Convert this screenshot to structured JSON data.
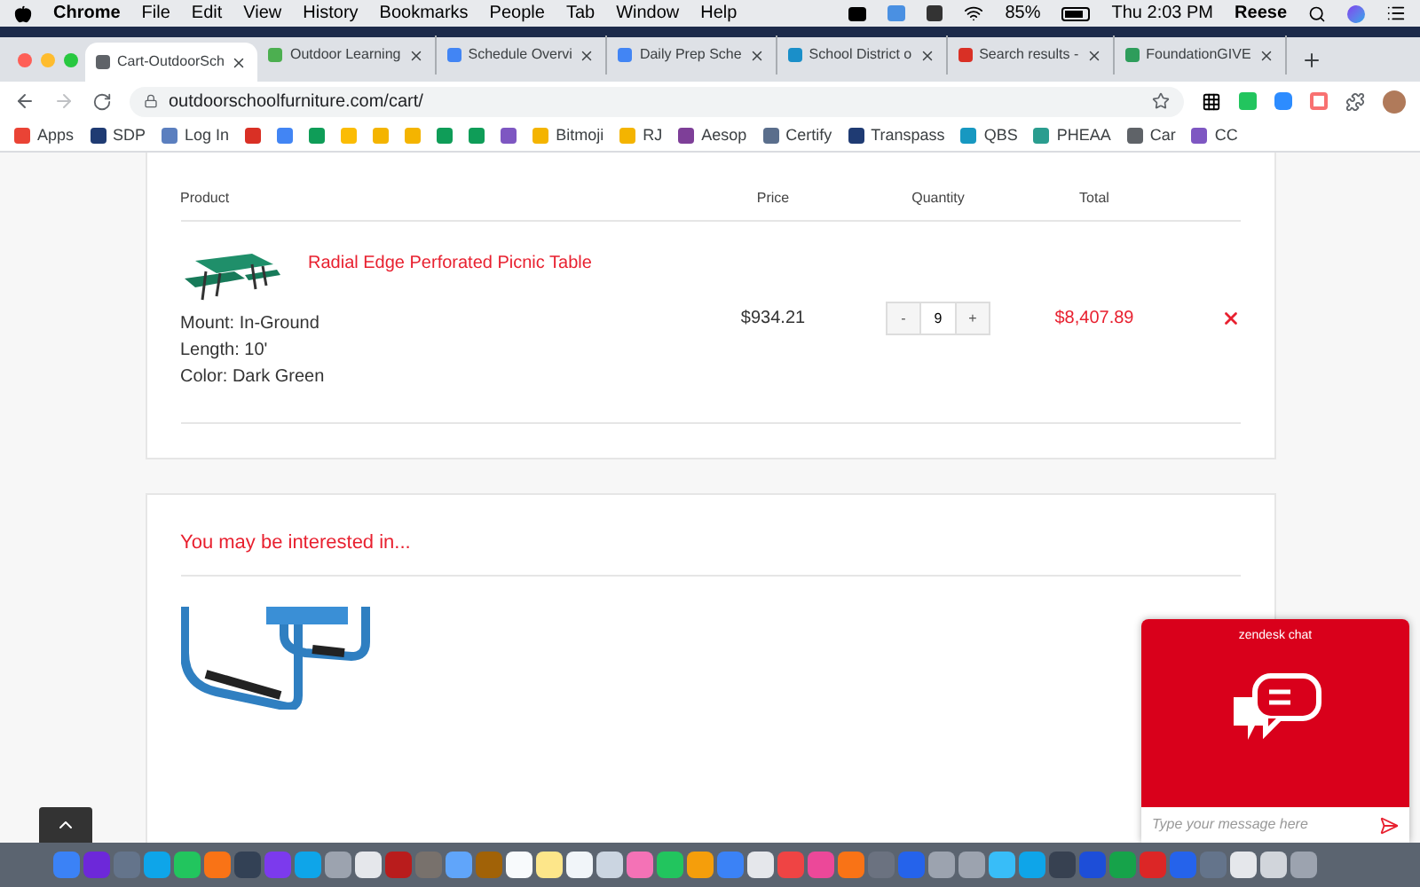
{
  "menu_bar": {
    "app": "Chrome",
    "items": [
      "File",
      "Edit",
      "View",
      "History",
      "Bookmarks",
      "People",
      "Tab",
      "Window",
      "Help"
    ],
    "battery": "85%",
    "clock": "Thu 2:03 PM",
    "user": "Reese"
  },
  "tabs": [
    {
      "title": "Cart-OutdoorSch",
      "selected": true,
      "color": "#5f6368"
    },
    {
      "title": "Outdoor Learning",
      "selected": false,
      "color": "#4caf50"
    },
    {
      "title": "Schedule Overvi",
      "selected": false,
      "color": "#4285f4"
    },
    {
      "title": "Daily Prep Sche",
      "selected": false,
      "color": "#4285f4"
    },
    {
      "title": "School District o",
      "selected": false,
      "color": "#1a8fc9"
    },
    {
      "title": "Search results -",
      "selected": false,
      "color": "#d93025"
    },
    {
      "title": "FoundationGIVE",
      "selected": false,
      "color": "#2e9d5b"
    }
  ],
  "address_bar": {
    "url": "outdoorschoolfurniture.com/cart/"
  },
  "bookmarks": [
    {
      "label": "Apps",
      "color": "#ea4335"
    },
    {
      "label": "SDP",
      "color": "#1f3b73"
    },
    {
      "label": "Log In",
      "color": "#5b7fbf"
    },
    {
      "color": "#d93025"
    },
    {
      "color": "#4285f4"
    },
    {
      "color": "#0f9d58"
    },
    {
      "color": "#fbbc04"
    },
    {
      "color": "#f4b400"
    },
    {
      "color": "#f4b400"
    },
    {
      "color": "#0f9d58"
    },
    {
      "color": "#0f9d58"
    },
    {
      "color": "#7e57c2"
    },
    {
      "label": "Bitmoji",
      "color": "#f4b400"
    },
    {
      "label": "RJ",
      "color": "#f4b400"
    },
    {
      "label": "Aesop",
      "color": "#7e3f98"
    },
    {
      "label": "Certify",
      "color": "#5a6e8c"
    },
    {
      "label": "Transpass",
      "color": "#1f3b73"
    },
    {
      "label": "QBS",
      "color": "#1798c1"
    },
    {
      "label": "PHEAA",
      "color": "#2a9d8f"
    },
    {
      "label": "Car",
      "color": "#5f6368"
    },
    {
      "label": "CC",
      "color": "#7e57c2"
    }
  ],
  "cart": {
    "columns": [
      "Product",
      "Price",
      "Quantity",
      "Total"
    ],
    "rows": [
      {
        "name": "Radial Edge Perforated Picnic Table",
        "options": [
          "Mount: In-Ground",
          "Length: 10'",
          "Color: Dark Green"
        ],
        "price": "$934.21",
        "quantity": "9",
        "decrement": "-",
        "increment": "+",
        "total": "$8,407.89"
      }
    ]
  },
  "recommendations": {
    "heading": "You may be interested in..."
  },
  "chat": {
    "title": "zendesk chat",
    "placeholder": "Type your message here"
  }
}
